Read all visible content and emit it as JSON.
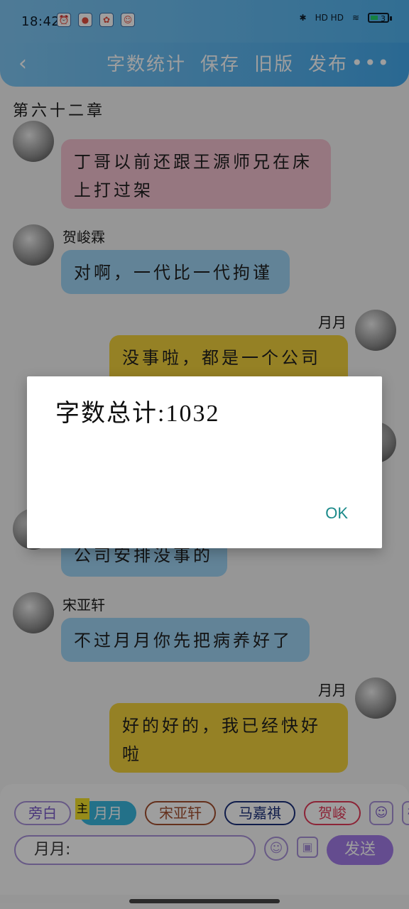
{
  "status": {
    "time": "18:42",
    "left_icons": [
      "alarm-icon",
      "app-icon",
      "app-icon",
      "app-icon"
    ],
    "right_text": "HD HD",
    "battery_level": "3"
  },
  "header": {
    "back_label": "‹",
    "actions": [
      "字数统计",
      "保存",
      "旧版",
      "发布"
    ],
    "more_label": "•••"
  },
  "chapter_title": "第六十二章",
  "messages": [
    {
      "sender": "",
      "text": "丁哥以前还跟王源师兄在床上打过架",
      "color": "pink"
    },
    {
      "sender": "贺峻霖",
      "text": "对啊，一代比一代拘谨",
      "color": "blue"
    },
    {
      "sender": "月月",
      "text": "没事啦，都是一个公司",
      "color": "yellow"
    },
    {
      "sender": "",
      "text": "公司安排没事的",
      "color": "blue"
    },
    {
      "sender": "宋亚轩",
      "text": "不过月月你先把病养好了",
      "color": "blue"
    },
    {
      "sender": "月月",
      "text": "好的好的，我已经快好啦",
      "color": "yellow"
    }
  ],
  "dialog": {
    "title": "字数总计:1032",
    "ok_label": "OK"
  },
  "bottom": {
    "chips": [
      "旁白",
      "月月",
      "宋亚轩",
      "马嘉祺",
      "贺峻"
    ],
    "selected_tag": "主",
    "icons": [
      "person-icon",
      "标"
    ],
    "input_value": "月月:",
    "send_label": "发送"
  }
}
